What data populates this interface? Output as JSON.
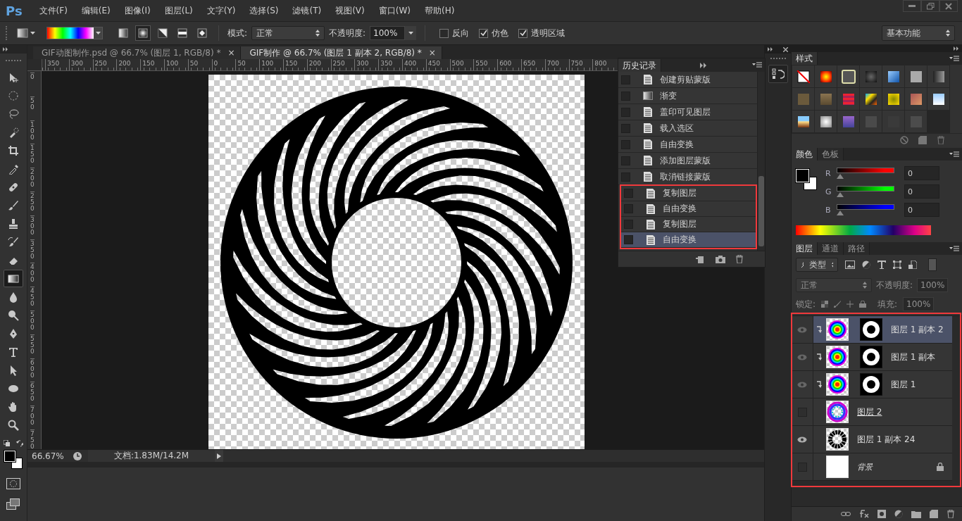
{
  "menu_bar": {
    "logo": "Ps",
    "menus": [
      "文件(F)",
      "编辑(E)",
      "图像(I)",
      "图层(L)",
      "文字(Y)",
      "选择(S)",
      "滤镜(T)",
      "视图(V)",
      "窗口(W)",
      "帮助(H)"
    ]
  },
  "options_bar": {
    "gradient_types": [
      {
        "kind": "linear",
        "selected": false
      },
      {
        "kind": "radial",
        "selected": true
      },
      {
        "kind": "angle",
        "selected": false
      },
      {
        "kind": "reflected",
        "selected": false
      },
      {
        "kind": "diamond",
        "selected": false
      }
    ],
    "mode_label": "模式:",
    "mode": "正常",
    "opacity_label": "不透明度:",
    "opacity": "100%",
    "checkboxes": [
      {
        "label": "反向",
        "checked": false
      },
      {
        "label": "仿色",
        "checked": true
      },
      {
        "label": "透明区域",
        "checked": true
      }
    ],
    "workspace": "基本功能"
  },
  "tools": [
    {
      "kind": "move",
      "selected": false
    },
    {
      "kind": "marquee",
      "selected": false
    },
    {
      "kind": "lasso",
      "selected": false
    },
    {
      "kind": "quick-select",
      "selected": false
    },
    {
      "kind": "crop",
      "selected": false
    },
    {
      "kind": "eyedropper",
      "selected": false
    },
    {
      "kind": "healing",
      "selected": false
    },
    {
      "kind": "brush",
      "selected": false
    },
    {
      "kind": "stamp",
      "selected": false
    },
    {
      "kind": "history-brush",
      "selected": false
    },
    {
      "kind": "eraser",
      "selected": false
    },
    {
      "kind": "gradient",
      "selected": true
    },
    {
      "kind": "blur",
      "selected": false
    },
    {
      "kind": "dodge",
      "selected": false
    },
    {
      "kind": "pen",
      "selected": false
    },
    {
      "kind": "type",
      "selected": false
    },
    {
      "kind": "path-select",
      "selected": false
    },
    {
      "kind": "ellipse",
      "selected": false
    },
    {
      "kind": "hand",
      "selected": false
    },
    {
      "kind": "zoom",
      "selected": false
    }
  ],
  "document_tabs": [
    {
      "title": "GIF动图制作.psd @ 66.7% (图层 1, RGB/8) *",
      "close": "×",
      "selected": false
    },
    {
      "title": "GIF制作 @ 66.7% (图层 1 副本 2, RGB/8) *",
      "close": "×",
      "selected": true
    }
  ],
  "rulers": {
    "horizontal": [
      "350",
      "300",
      "250",
      "200",
      "150",
      "100",
      "50",
      "0",
      "50",
      "100",
      "150",
      "200",
      "250",
      "300",
      "350",
      "400",
      "450",
      "500",
      "550",
      "600",
      "650",
      "700",
      "750",
      "800"
    ],
    "vertical": [
      "0",
      "50",
      "100",
      "150",
      "200",
      "250",
      "300",
      "350",
      "400",
      "450",
      "500",
      "550",
      "600",
      "650",
      "700",
      "750"
    ]
  },
  "status_bar": {
    "zoom": "66.67%",
    "doc_info": "文档:1.83M/14.2M"
  },
  "history_panel": {
    "title": "历史记录",
    "items": [
      {
        "name": "创建剪贴蒙版",
        "kind": "document",
        "selected": false
      },
      {
        "name": "渐变",
        "kind": "gradient",
        "selected": false
      },
      {
        "name": "盖印可见图层",
        "kind": "document",
        "selected": false
      },
      {
        "name": "载入选区",
        "kind": "document",
        "selected": false
      },
      {
        "name": "自由变换",
        "kind": "document",
        "selected": false
      },
      {
        "name": "添加图层蒙版",
        "kind": "document",
        "selected": false
      },
      {
        "name": "取消链接蒙版",
        "kind": "document",
        "selected": false
      },
      {
        "name": "复制图层",
        "kind": "document",
        "selected": false
      },
      {
        "name": "自由变换",
        "kind": "document",
        "selected": false
      },
      {
        "name": "复制图层",
        "kind": "document",
        "selected": false
      },
      {
        "name": "自由变换",
        "kind": "document",
        "selected": true
      }
    ]
  },
  "styles_panel": {
    "title": "样式"
  },
  "color_panel": {
    "tabs": [
      {
        "label": "颜色",
        "selected": true
      },
      {
        "label": "色板",
        "selected": false
      }
    ],
    "channels": [
      {
        "label": "R",
        "color": "#ff0000",
        "level": 0,
        "value": "0"
      },
      {
        "label": "G",
        "color": "#00ff00",
        "level": 0,
        "value": "0"
      },
      {
        "label": "B",
        "color": "#0000ff",
        "level": 0,
        "value": "0"
      }
    ]
  },
  "layers_panel": {
    "tabs": [
      {
        "label": "图层",
        "selected": true
      },
      {
        "label": "通道",
        "selected": false
      },
      {
        "label": "路径",
        "selected": false
      }
    ],
    "filter": "类型",
    "blend_mode": "正常",
    "opacity_label": "不透明度:",
    "opacity": "100%",
    "lock_label": "锁定:",
    "fill_label": "填充:",
    "fill": "100%",
    "disabled": true,
    "layers": [
      {
        "name": "图层 1 副本 2",
        "kind": "normal",
        "thumbnail": {
          "kind": "rainbow"
        },
        "mask": true,
        "clipped": true,
        "visible": true,
        "clip_base": false,
        "locked": false,
        "selected": true
      },
      {
        "name": "图层 1 副本",
        "kind": "normal",
        "thumbnail": {
          "kind": "rainbow"
        },
        "mask": true,
        "clipped": true,
        "visible": true,
        "clip_base": false,
        "locked": false,
        "selected": false
      },
      {
        "name": "图层 1",
        "kind": "normal",
        "thumbnail": {
          "kind": "rainbow"
        },
        "mask": true,
        "clipped": true,
        "visible": true,
        "clip_base": false,
        "locked": false,
        "selected": false
      },
      {
        "name": "图层 2",
        "kind": "normal",
        "thumbnail": {
          "kind": "rainbow-ring"
        },
        "mask": false,
        "clipped": false,
        "visible": false,
        "clip_base": true,
        "locked": false,
        "selected": false
      },
      {
        "name": "图层 1 副本 24",
        "kind": "normal",
        "thumbnail": {
          "kind": "spiral"
        },
        "mask": false,
        "clipped": false,
        "visible": true,
        "clip_base": false,
        "locked": false,
        "selected": false
      },
      {
        "name": "背景",
        "kind": "background",
        "thumbnail": {
          "kind": "white"
        },
        "mask": false,
        "clipped": false,
        "visible": false,
        "clip_base": false,
        "locked": true,
        "selected": false
      }
    ]
  }
}
